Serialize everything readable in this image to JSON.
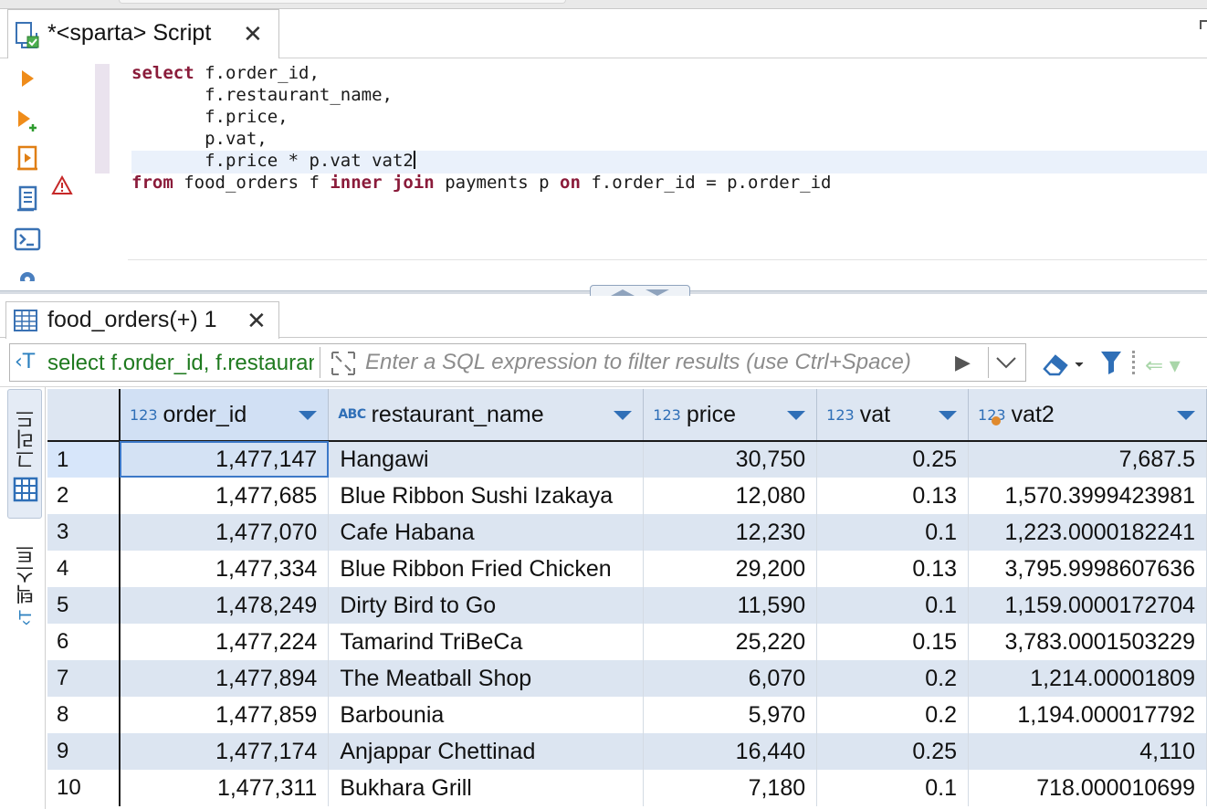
{
  "editor": {
    "tab_title": "*<sparta> Script",
    "close_glyph": "✕",
    "code_lines": [
      [
        {
          "t": "select",
          "kw": true
        },
        {
          "t": " f.order_id,",
          "kw": false
        }
      ],
      [
        {
          "t": "       f.restaurant_name,",
          "kw": false
        }
      ],
      [
        {
          "t": "       f.price,",
          "kw": false
        }
      ],
      [
        {
          "t": "       p.vat,",
          "kw": false
        }
      ],
      [
        {
          "t": "       f.price * p.vat vat2",
          "kw": false
        }
      ],
      [
        {
          "t": "from",
          "kw": true
        },
        {
          "t": " food_orders f ",
          "kw": false
        },
        {
          "t": "inner join",
          "kw": true
        },
        {
          "t": " payments p ",
          "kw": false
        },
        {
          "t": "on",
          "kw": true
        },
        {
          "t": " f.order_id = p.order_id",
          "kw": false
        }
      ]
    ],
    "tools": [
      "run-statement-icon",
      "run-new-tab-icon",
      "execute-script-icon",
      "explain-plan-icon",
      "terminal-icon",
      "settings-icon"
    ],
    "warning_icon": "warning-icon"
  },
  "results": {
    "tab_title": "food_orders(+) 1",
    "close_glyph": "✕",
    "filter": {
      "query_icon": "‹T",
      "query_text": "select f.order_id, f.restaurant_name",
      "placeholder": "Enter a SQL expression to filter results (use Ctrl+Space)",
      "run_glyph": "▶",
      "back_glyph": "⇐ ▾"
    },
    "side_tabs": {
      "grid_label": "그리드",
      "text_label": "텍스트",
      "text_icon": "‹T"
    },
    "columns": [
      {
        "type": "123",
        "name": "order_id"
      },
      {
        "type": "ABC",
        "name": "restaurant_name"
      },
      {
        "type": "123",
        "name": "price"
      },
      {
        "type": "123",
        "name": "vat"
      },
      {
        "type": "123",
        "name": "vat2"
      }
    ],
    "rows": [
      {
        "n": "1",
        "order_id": "1,477,147",
        "restaurant_name": "Hangawi",
        "price": "30,750",
        "vat": "0.25",
        "vat2": "7,687.5"
      },
      {
        "n": "2",
        "order_id": "1,477,685",
        "restaurant_name": "Blue Ribbon Sushi Izakaya",
        "price": "12,080",
        "vat": "0.13",
        "vat2": "1,570.3999423981"
      },
      {
        "n": "3",
        "order_id": "1,477,070",
        "restaurant_name": "Cafe Habana",
        "price": "12,230",
        "vat": "0.1",
        "vat2": "1,223.0000182241"
      },
      {
        "n": "4",
        "order_id": "1,477,334",
        "restaurant_name": "Blue Ribbon Fried Chicken",
        "price": "29,200",
        "vat": "0.13",
        "vat2": "3,795.9998607636"
      },
      {
        "n": "5",
        "order_id": "1,478,249",
        "restaurant_name": "Dirty Bird to Go",
        "price": "11,590",
        "vat": "0.1",
        "vat2": "1,159.0000172704"
      },
      {
        "n": "6",
        "order_id": "1,477,224",
        "restaurant_name": "Tamarind TriBeCa",
        "price": "25,220",
        "vat": "0.15",
        "vat2": "3,783.0001503229"
      },
      {
        "n": "7",
        "order_id": "1,477,894",
        "restaurant_name": "The Meatball Shop",
        "price": "6,070",
        "vat": "0.2",
        "vat2": "1,214.00001809"
      },
      {
        "n": "8",
        "order_id": "1,477,859",
        "restaurant_name": "Barbounia",
        "price": "5,970",
        "vat": "0.2",
        "vat2": "1,194.000017792"
      },
      {
        "n": "9",
        "order_id": "1,477,174",
        "restaurant_name": "Anjappar Chettinad",
        "price": "16,440",
        "vat": "0.25",
        "vat2": "4,110"
      },
      {
        "n": "10",
        "order_id": "1,477,311",
        "restaurant_name": "Bukhara Grill",
        "price": "7,180",
        "vat": "0.1",
        "vat2": "718.000010699"
      }
    ]
  },
  "colors": {
    "keyword": "#8a1b3a",
    "query_text": "#1f7a1f",
    "accent": "#2f6fb7",
    "row_alt": "#dce5f1"
  }
}
